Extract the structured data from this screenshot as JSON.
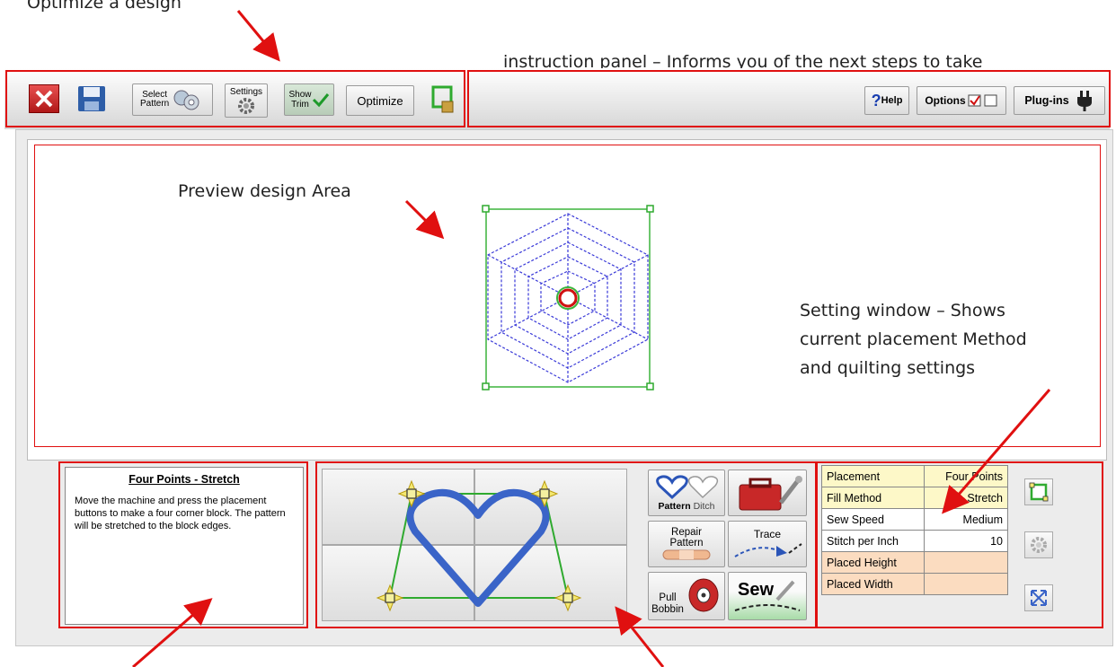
{
  "annotations": {
    "optimize_title": "Optimize a design",
    "instruction_panel": "instruction panel –  Informs you of the next steps to take",
    "preview_area": "Preview design Area",
    "settings_window": [
      "Setting window – Shows",
      "current placement Method",
      "and quilting settings"
    ]
  },
  "toolbar": {
    "select_pattern": [
      "Select",
      "Pattern"
    ],
    "settings": "Settings",
    "show_trim": [
      "Show",
      "Trim"
    ],
    "optimize": "Optimize",
    "help": "Help",
    "options": "Options",
    "plugins": "Plug-ins"
  },
  "instructions": {
    "title": "Four Points - Stretch",
    "body": "Move the machine and press the placement buttons to make a four corner block. The pattern will be stretched to the block edges."
  },
  "tools": {
    "pattern": "Pattern",
    "ditch": "Ditch",
    "repair_pattern": [
      "Repair",
      "Pattern"
    ],
    "trace": "Trace",
    "pull_bobbin": [
      "Pull",
      "Bobbin"
    ],
    "sew": "Sew"
  },
  "settings": {
    "placement_label": "Placement",
    "placement_value": "Four Points",
    "fill_label": "Fill Method",
    "fill_value": "Stretch",
    "speed_label": "Sew Speed",
    "speed_value": "Medium",
    "spi_label": "Stitch per Inch",
    "spi_value": "10",
    "height_label": "Placed Height",
    "height_value": "",
    "width_label": "Placed Width",
    "width_value": ""
  },
  "colors": {
    "annotation_red": "#e01010",
    "pattern_blue": "#3a3ad8",
    "outline_green": "#3cb43c"
  }
}
